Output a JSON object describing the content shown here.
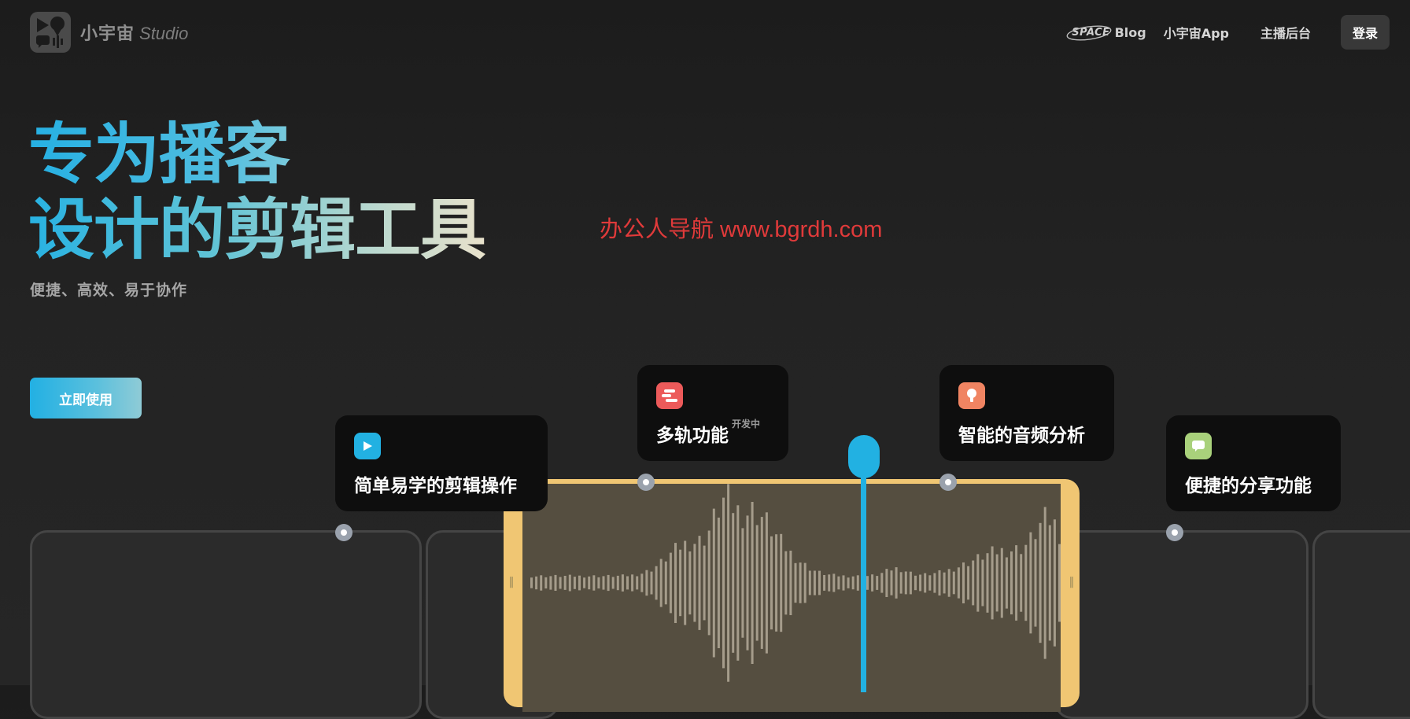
{
  "brand": {
    "name_cn": "小宇宙",
    "name_en": "Studio",
    "logo_icon": "podcast-logo-icon"
  },
  "nav": {
    "space_badge": "SPACE",
    "blog": "Blog",
    "app": "小宇宙App",
    "host_dashboard": "主播后台",
    "login": "登录"
  },
  "hero": {
    "title_line1": "专为播客",
    "title_line2": "设计的剪辑工具",
    "subtitle": "便捷、高效、易于协作",
    "cta": "立即使用"
  },
  "watermark": "办公人导航  www.bgrdh.com",
  "features": [
    {
      "label": "简单易学的剪辑操作",
      "icon": "play-icon",
      "color": "#22b1e2"
    },
    {
      "label": "多轨功能",
      "tag": "开发中",
      "icon": "multitrack-icon",
      "color": "#ec5a5a"
    },
    {
      "label": "智能的音频分析",
      "icon": "lightbulb-icon",
      "color": "#f08462"
    },
    {
      "label": "便捷的分享功能",
      "icon": "chat-bubble-icon",
      "color": "#a9d17b"
    }
  ],
  "colors": {
    "accent_blue": "#22b1e2",
    "clip_yellow": "#f0c673",
    "watermark_red": "#e03a3a",
    "background": "#232323"
  }
}
